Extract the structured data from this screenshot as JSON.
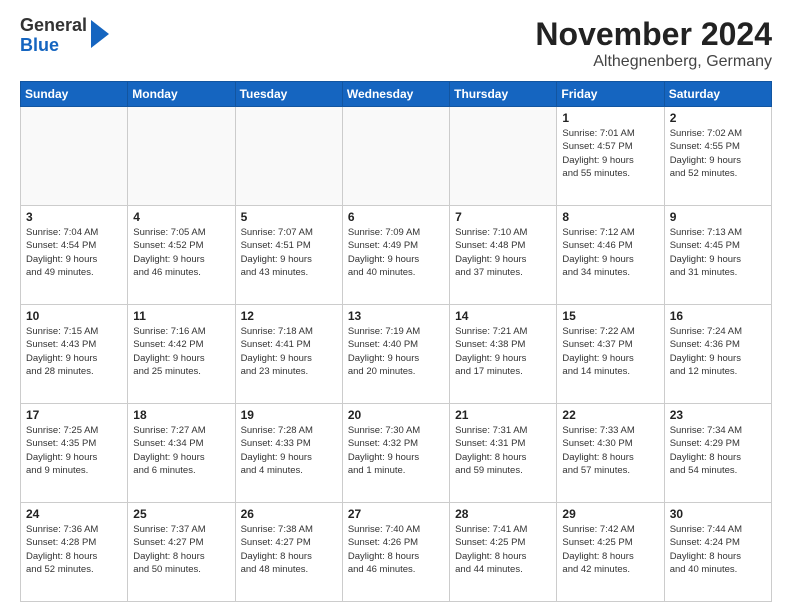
{
  "header": {
    "logo_general": "General",
    "logo_blue": "Blue",
    "title": "November 2024",
    "subtitle": "Althegnenberg, Germany"
  },
  "days_of_week": [
    "Sunday",
    "Monday",
    "Tuesday",
    "Wednesday",
    "Thursday",
    "Friday",
    "Saturday"
  ],
  "weeks": [
    [
      {
        "day": "",
        "info": ""
      },
      {
        "day": "",
        "info": ""
      },
      {
        "day": "",
        "info": ""
      },
      {
        "day": "",
        "info": ""
      },
      {
        "day": "",
        "info": ""
      },
      {
        "day": "1",
        "info": "Sunrise: 7:01 AM\nSunset: 4:57 PM\nDaylight: 9 hours\nand 55 minutes."
      },
      {
        "day": "2",
        "info": "Sunrise: 7:02 AM\nSunset: 4:55 PM\nDaylight: 9 hours\nand 52 minutes."
      }
    ],
    [
      {
        "day": "3",
        "info": "Sunrise: 7:04 AM\nSunset: 4:54 PM\nDaylight: 9 hours\nand 49 minutes."
      },
      {
        "day": "4",
        "info": "Sunrise: 7:05 AM\nSunset: 4:52 PM\nDaylight: 9 hours\nand 46 minutes."
      },
      {
        "day": "5",
        "info": "Sunrise: 7:07 AM\nSunset: 4:51 PM\nDaylight: 9 hours\nand 43 minutes."
      },
      {
        "day": "6",
        "info": "Sunrise: 7:09 AM\nSunset: 4:49 PM\nDaylight: 9 hours\nand 40 minutes."
      },
      {
        "day": "7",
        "info": "Sunrise: 7:10 AM\nSunset: 4:48 PM\nDaylight: 9 hours\nand 37 minutes."
      },
      {
        "day": "8",
        "info": "Sunrise: 7:12 AM\nSunset: 4:46 PM\nDaylight: 9 hours\nand 34 minutes."
      },
      {
        "day": "9",
        "info": "Sunrise: 7:13 AM\nSunset: 4:45 PM\nDaylight: 9 hours\nand 31 minutes."
      }
    ],
    [
      {
        "day": "10",
        "info": "Sunrise: 7:15 AM\nSunset: 4:43 PM\nDaylight: 9 hours\nand 28 minutes."
      },
      {
        "day": "11",
        "info": "Sunrise: 7:16 AM\nSunset: 4:42 PM\nDaylight: 9 hours\nand 25 minutes."
      },
      {
        "day": "12",
        "info": "Sunrise: 7:18 AM\nSunset: 4:41 PM\nDaylight: 9 hours\nand 23 minutes."
      },
      {
        "day": "13",
        "info": "Sunrise: 7:19 AM\nSunset: 4:40 PM\nDaylight: 9 hours\nand 20 minutes."
      },
      {
        "day": "14",
        "info": "Sunrise: 7:21 AM\nSunset: 4:38 PM\nDaylight: 9 hours\nand 17 minutes."
      },
      {
        "day": "15",
        "info": "Sunrise: 7:22 AM\nSunset: 4:37 PM\nDaylight: 9 hours\nand 14 minutes."
      },
      {
        "day": "16",
        "info": "Sunrise: 7:24 AM\nSunset: 4:36 PM\nDaylight: 9 hours\nand 12 minutes."
      }
    ],
    [
      {
        "day": "17",
        "info": "Sunrise: 7:25 AM\nSunset: 4:35 PM\nDaylight: 9 hours\nand 9 minutes."
      },
      {
        "day": "18",
        "info": "Sunrise: 7:27 AM\nSunset: 4:34 PM\nDaylight: 9 hours\nand 6 minutes."
      },
      {
        "day": "19",
        "info": "Sunrise: 7:28 AM\nSunset: 4:33 PM\nDaylight: 9 hours\nand 4 minutes."
      },
      {
        "day": "20",
        "info": "Sunrise: 7:30 AM\nSunset: 4:32 PM\nDaylight: 9 hours\nand 1 minute."
      },
      {
        "day": "21",
        "info": "Sunrise: 7:31 AM\nSunset: 4:31 PM\nDaylight: 8 hours\nand 59 minutes."
      },
      {
        "day": "22",
        "info": "Sunrise: 7:33 AM\nSunset: 4:30 PM\nDaylight: 8 hours\nand 57 minutes."
      },
      {
        "day": "23",
        "info": "Sunrise: 7:34 AM\nSunset: 4:29 PM\nDaylight: 8 hours\nand 54 minutes."
      }
    ],
    [
      {
        "day": "24",
        "info": "Sunrise: 7:36 AM\nSunset: 4:28 PM\nDaylight: 8 hours\nand 52 minutes."
      },
      {
        "day": "25",
        "info": "Sunrise: 7:37 AM\nSunset: 4:27 PM\nDaylight: 8 hours\nand 50 minutes."
      },
      {
        "day": "26",
        "info": "Sunrise: 7:38 AM\nSunset: 4:27 PM\nDaylight: 8 hours\nand 48 minutes."
      },
      {
        "day": "27",
        "info": "Sunrise: 7:40 AM\nSunset: 4:26 PM\nDaylight: 8 hours\nand 46 minutes."
      },
      {
        "day": "28",
        "info": "Sunrise: 7:41 AM\nSunset: 4:25 PM\nDaylight: 8 hours\nand 44 minutes."
      },
      {
        "day": "29",
        "info": "Sunrise: 7:42 AM\nSunset: 4:25 PM\nDaylight: 8 hours\nand 42 minutes."
      },
      {
        "day": "30",
        "info": "Sunrise: 7:44 AM\nSunset: 4:24 PM\nDaylight: 8 hours\nand 40 minutes."
      }
    ]
  ]
}
